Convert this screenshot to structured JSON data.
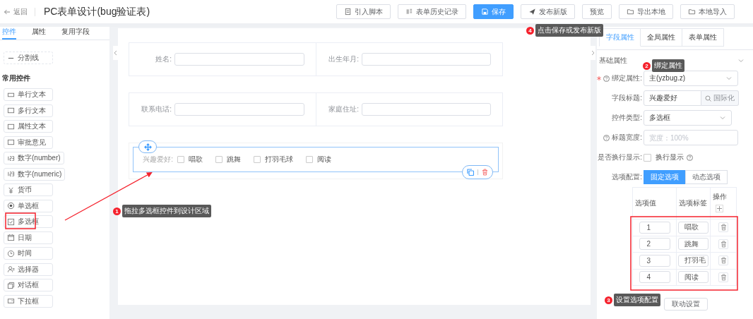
{
  "header": {
    "back": "返回",
    "title": "PC表单设计(bug验证表)",
    "buttons": [
      {
        "label": "引入脚本",
        "kind": "document",
        "primary": false
      },
      {
        "label": "表单历史记录",
        "kind": "list",
        "primary": false
      },
      {
        "label": "保存",
        "kind": "save",
        "primary": true
      },
      {
        "label": "发布新版",
        "kind": "send",
        "primary": false
      },
      {
        "label": "预览",
        "kind": "plain",
        "primary": false
      },
      {
        "label": "导出本地",
        "kind": "folder",
        "primary": false
      },
      {
        "label": "本地导入",
        "kind": "folder",
        "primary": false
      }
    ]
  },
  "left_panel": {
    "tabs": [
      {
        "label": "控件",
        "selected": true
      },
      {
        "label": "属性",
        "selected": false
      },
      {
        "label": "复用字段",
        "selected": false
      }
    ],
    "divider_item": {
      "label": "分割线",
      "kind": "dash"
    },
    "section_title": "常用控件",
    "items": [
      {
        "label": "单行文本",
        "kind": "input"
      },
      {
        "label": "多行文本",
        "kind": "textarea"
      },
      {
        "label": "属性文本",
        "kind": "textarea"
      },
      {
        "label": "审批意见",
        "kind": "textarea"
      },
      {
        "label": "数字(number)",
        "kind": "number"
      },
      {
        "label": "数字(numeric)",
        "kind": "number"
      },
      {
        "label": "货币",
        "kind": "currency"
      },
      {
        "label": "单选框",
        "kind": "radio"
      },
      {
        "label": "多选框",
        "kind": "checkbox"
      },
      {
        "label": "日期",
        "kind": "date"
      },
      {
        "label": "时间",
        "kind": "time"
      },
      {
        "label": "选择器",
        "kind": "user"
      },
      {
        "label": "对话框",
        "kind": "dialog"
      },
      {
        "label": "下拉框",
        "kind": "dropdown"
      }
    ]
  },
  "canvas": {
    "rows": [
      {
        "fields": [
          {
            "label": "姓名:"
          },
          {
            "label": "出生年月:"
          }
        ]
      },
      {
        "fields": [
          {
            "label": "联系电话:"
          },
          {
            "label": "家庭住址:"
          }
        ]
      }
    ],
    "checkbox_field": {
      "label": "兴趣爱好:",
      "selected": true,
      "options": [
        {
          "label": "唱歌",
          "checked": false
        },
        {
          "label": "跳舞",
          "checked": false
        },
        {
          "label": "打羽毛球",
          "checked": false
        },
        {
          "label": "阅读",
          "checked": false
        }
      ]
    }
  },
  "properties": {
    "tabs": [
      {
        "label": "字段属性",
        "selected": true
      },
      {
        "label": "全局属性",
        "selected": false
      },
      {
        "label": "表单属性",
        "selected": false
      }
    ],
    "section": {
      "title": "基础属性",
      "expanded": true
    },
    "fields": [
      {
        "kind": "select",
        "label": "绑定属性:",
        "required": true,
        "help": true,
        "value": "主(yzbug.z)"
      },
      {
        "kind": "input-addon",
        "label": "字段标题:",
        "required": false,
        "help": false,
        "value": "兴趣爱好",
        "addon": "国际化"
      },
      {
        "kind": "select",
        "label": "控件类型:",
        "required": false,
        "help": false,
        "value": "多选框"
      },
      {
        "kind": "input",
        "label": "标题宽度:",
        "required": false,
        "help": true,
        "placeholder": "宽度：100%"
      },
      {
        "kind": "checkbox",
        "label": "是否换行显示:",
        "required": false,
        "help": false,
        "text": "换行显示",
        "checked": false
      },
      {
        "kind": "radio-group",
        "label": "选项配置:",
        "required": false,
        "help": false,
        "options": [
          {
            "label": "固定选项",
            "selected": true
          },
          {
            "label": "动态选项",
            "selected": false
          }
        ]
      }
    ],
    "option_table": {
      "columns": [
        "选项值",
        "选项标签",
        "操作"
      ],
      "rows": [
        {
          "value": "1",
          "label": "唱歌"
        },
        {
          "value": "2",
          "label": "跳舞"
        },
        {
          "value": "3",
          "label": "打羽毛"
        },
        {
          "value": "4",
          "label": "阅读"
        }
      ]
    },
    "linkage_button": "联动设置"
  },
  "annotations": [
    {
      "number": "4",
      "text": "点击保存或发布新版"
    },
    {
      "number": "2",
      "text": "绑定属性"
    },
    {
      "number": "1",
      "text": "拖拉多选框控件到设计区域"
    },
    {
      "number": "3",
      "text": "设置选项配置"
    }
  ]
}
